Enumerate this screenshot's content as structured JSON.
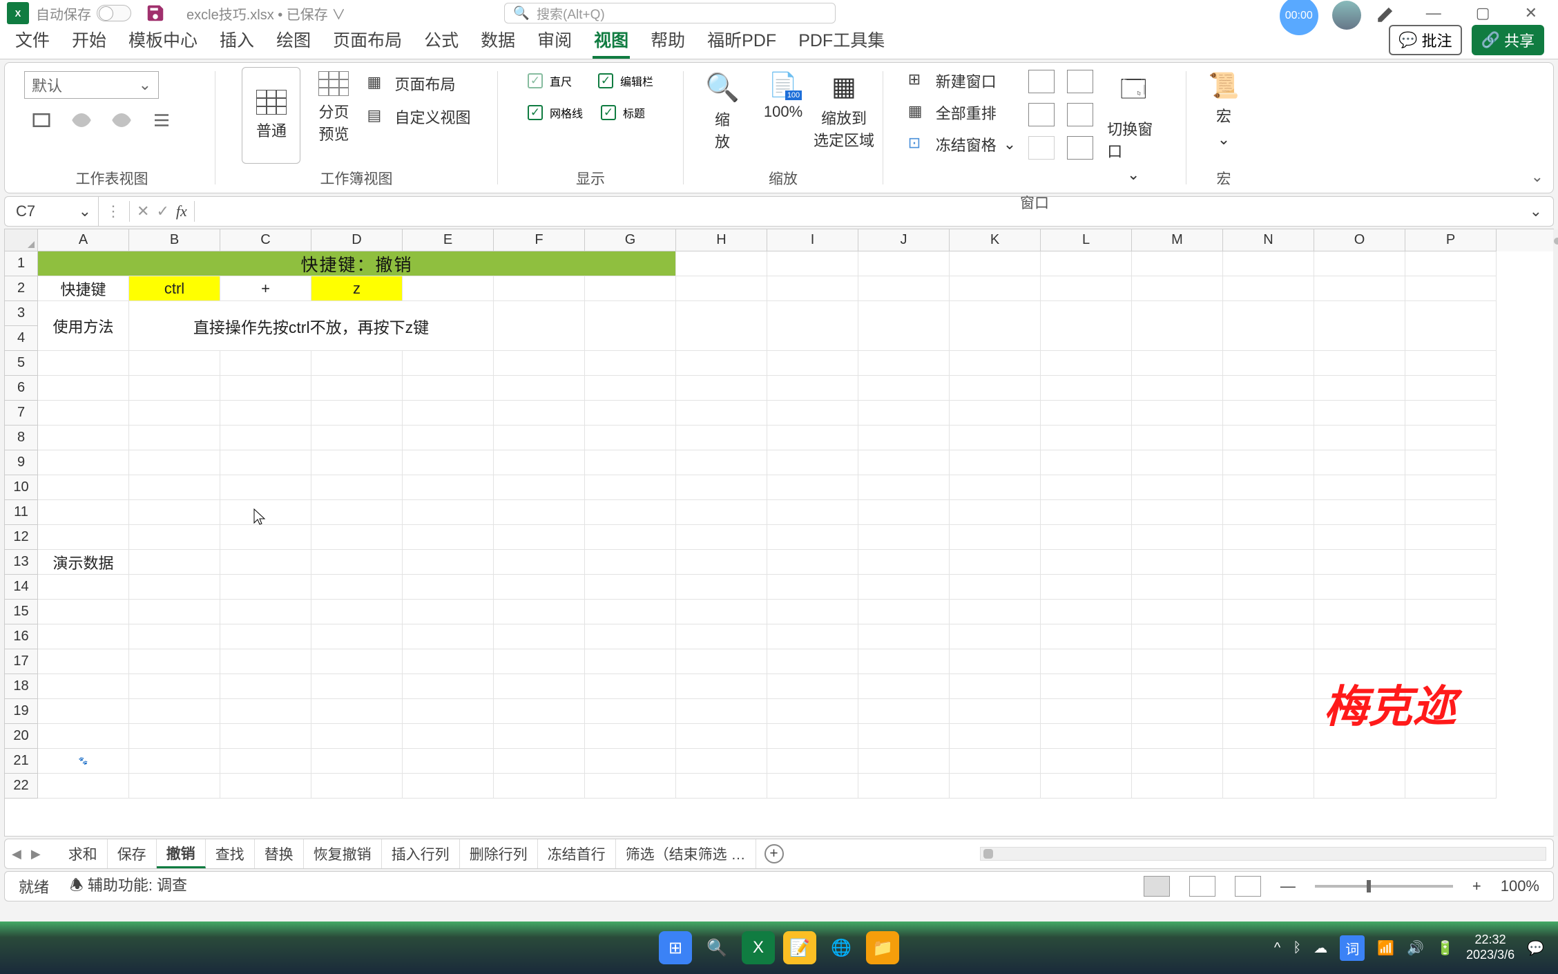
{
  "titlebar": {
    "autosave": "自动保存",
    "filename": "excle技巧.xlsx • 已保存 ∨",
    "search_placeholder": "搜索(Alt+Q)",
    "timer": "00:00"
  },
  "tabs": {
    "items": [
      "文件",
      "开始",
      "模板中心",
      "插入",
      "绘图",
      "页面布局",
      "公式",
      "数据",
      "审阅",
      "视图",
      "帮助",
      "福昕PDF",
      "PDF工具集"
    ],
    "active_index": 9,
    "annotate": "批注",
    "share": "共享"
  },
  "ribbon": {
    "group1_label": "工作表视图",
    "combo_default": "默认",
    "group2": {
      "label": "工作簿视图",
      "normal": "普通",
      "pagebreak": "分页\n预览",
      "pagelayout": "页面布局",
      "custom": "自定义视图"
    },
    "group3": {
      "label": "显示",
      "ruler": "直尺",
      "formula": "编辑栏",
      "gridlines": "网格线",
      "headings": "标题"
    },
    "group4": {
      "label": "缩放",
      "zoom": "缩\n放",
      "pct": "100%",
      "zoomsel": "缩放到\n选定区域"
    },
    "group5": {
      "label": "窗口",
      "neww": "新建窗口",
      "arrange": "全部重排",
      "freeze": "冻结窗格",
      "switch": "切换窗口"
    },
    "group6": {
      "label": "宏",
      "macros": "宏"
    }
  },
  "namebar": {
    "cell": "C7",
    "fx": "fx"
  },
  "grid": {
    "cols": [
      "A",
      "B",
      "C",
      "D",
      "E",
      "F",
      "G",
      "H",
      "I",
      "J",
      "K",
      "L",
      "M",
      "N",
      "O",
      "P"
    ],
    "rows": [
      "1",
      "2",
      "3",
      "4",
      "5",
      "6",
      "7",
      "8",
      "9",
      "10",
      "11",
      "12",
      "13",
      "14",
      "15",
      "16",
      "17",
      "18",
      "19",
      "20",
      "21",
      "22"
    ],
    "r1_title": "快捷键：撤销",
    "r2": {
      "a": "快捷键",
      "b": "ctrl",
      "c": "+",
      "d": "z"
    },
    "r3a": "使用方法",
    "r3span": "直接操作先按ctrl不放，再按下z键",
    "r13a": "演示数据",
    "watermark": "梅克迩"
  },
  "sheets": {
    "tabs": [
      "求和",
      "保存",
      "撤销",
      "查找",
      "替换",
      "恢复撤销",
      "插入行列",
      "删除行列",
      "冻结首行",
      "筛选（结束筛选 …"
    ],
    "active_index": 2
  },
  "status": {
    "ready": "就绪",
    "access": "辅助功能: 调查",
    "zoom": "100%"
  },
  "taskbar": {
    "time": "22:32",
    "date": "2023/3/6"
  }
}
